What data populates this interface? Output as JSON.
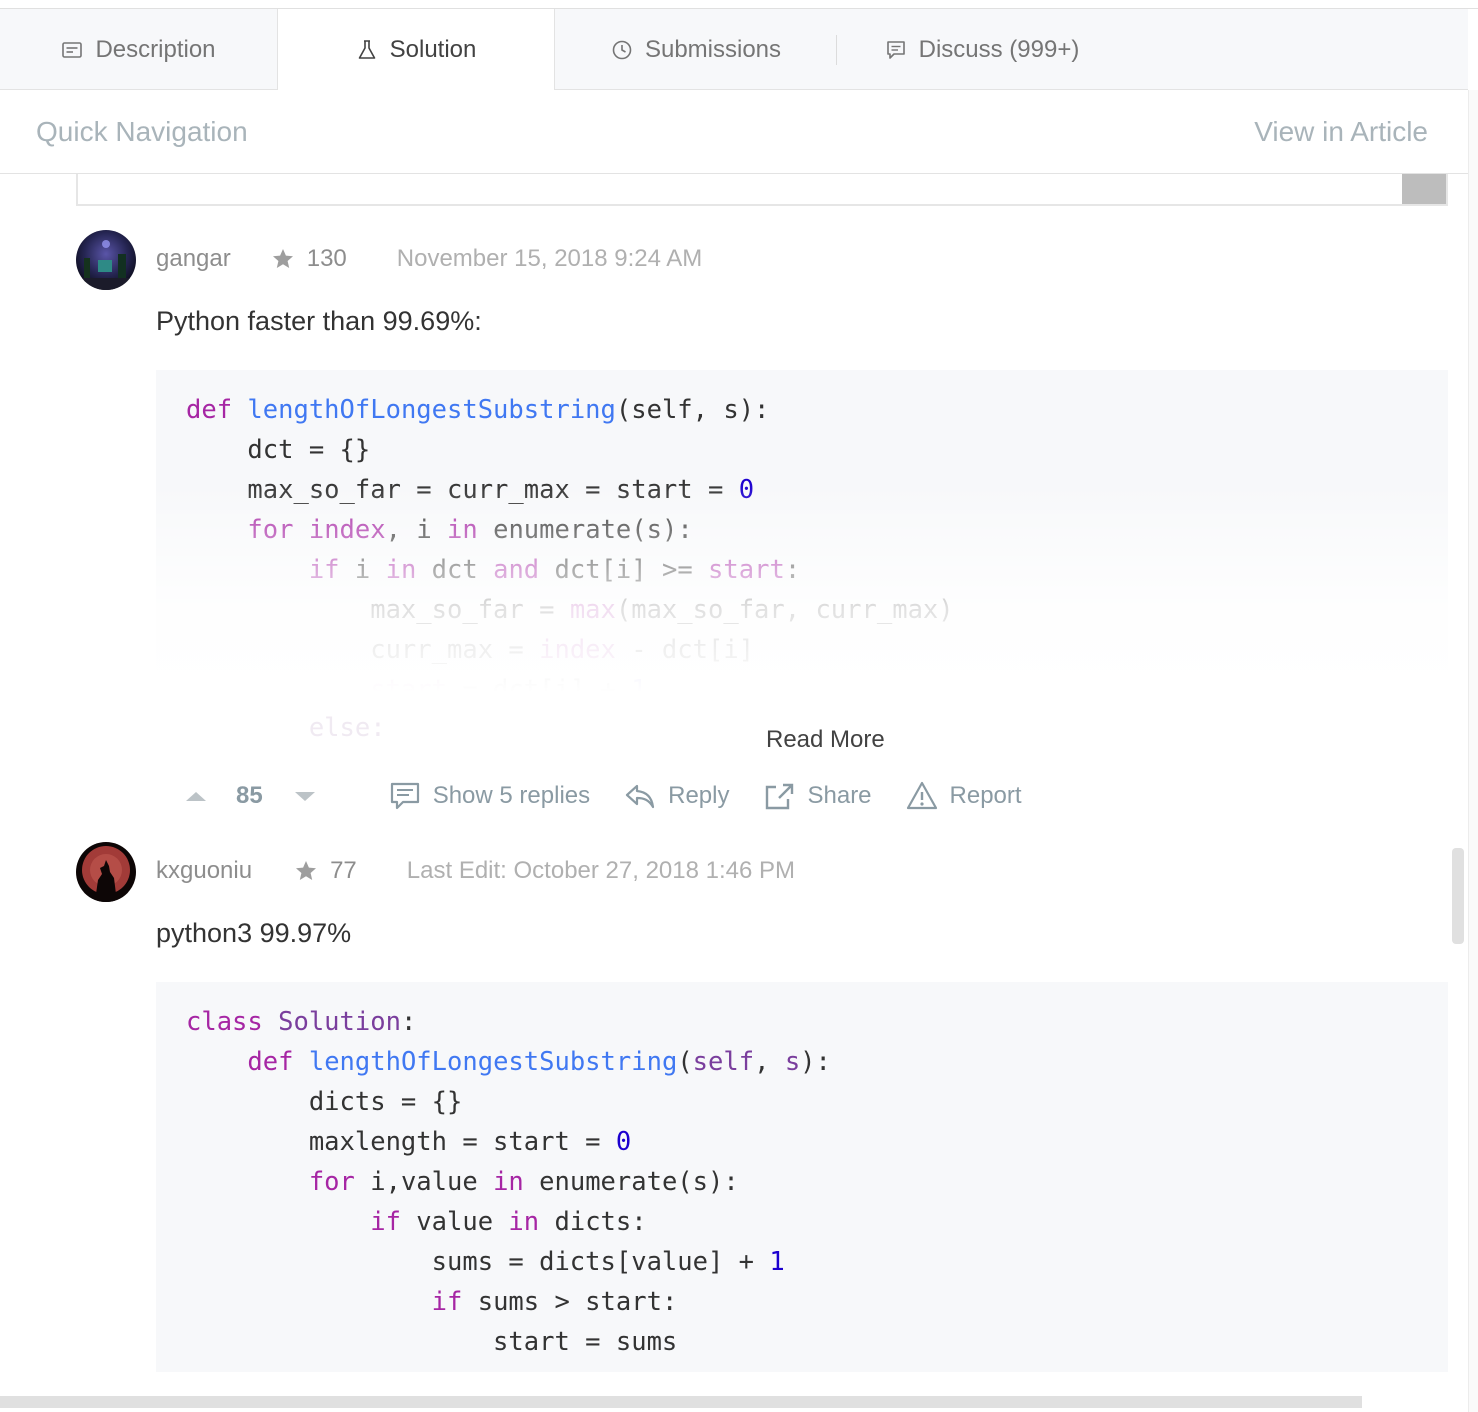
{
  "tabs": [
    {
      "label": "Description",
      "icon": "description-icon"
    },
    {
      "label": "Solution",
      "icon": "flask-icon",
      "active": true
    },
    {
      "label": "Submissions",
      "icon": "clock-icon"
    },
    {
      "label": "Discuss (999+)",
      "icon": "comment-icon"
    }
  ],
  "quick_nav": {
    "title": "Quick Navigation",
    "link": "View in Article"
  },
  "posts": [
    {
      "username": "gangar",
      "reputation": "130",
      "date": "November 15, 2018 9:24 AM",
      "text": "Python faster than 99.69%:",
      "read_more": "Read More",
      "votes": "85",
      "actions": {
        "show_replies": "Show 5 replies",
        "reply": "Reply",
        "share": "Share",
        "report": "Report"
      }
    },
    {
      "username": "kxguoniu",
      "reputation": "77",
      "date": "Last Edit: October 27, 2018 1:46 PM",
      "text": "python3 99.97%"
    }
  ],
  "colors": {
    "tab_bar_bg": "#f7f8fa",
    "code_bg": "#f7f8fa",
    "keyword": "#a626a4",
    "number": "#1c00cf",
    "muted_text": "#8d8d8d"
  }
}
